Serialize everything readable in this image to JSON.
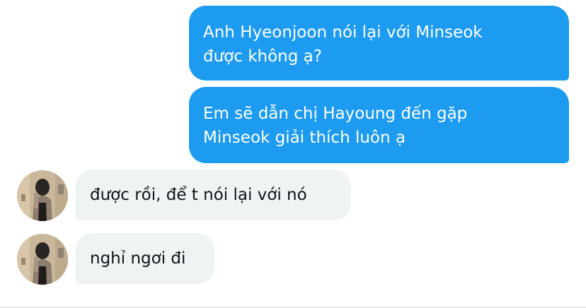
{
  "conversation": {
    "messages": [
      {
        "sender": "me",
        "text": "Anh Hyeonjoon nói lại với Minseok\nđược không ạ?"
      },
      {
        "sender": "me",
        "text": "Em sẽ dẫn chị Hayoung đến gặp\nMinseok giải thích luôn ạ"
      },
      {
        "sender": "other",
        "text": "được rồi, để t nói lại với nó"
      },
      {
        "sender": "other",
        "text": "nghỉ ngơi đi"
      }
    ]
  },
  "colors": {
    "sent_bubble": "#1d9bf0",
    "received_bubble": "#eff3f4"
  },
  "icons": {
    "avatar": "profile-photo"
  }
}
